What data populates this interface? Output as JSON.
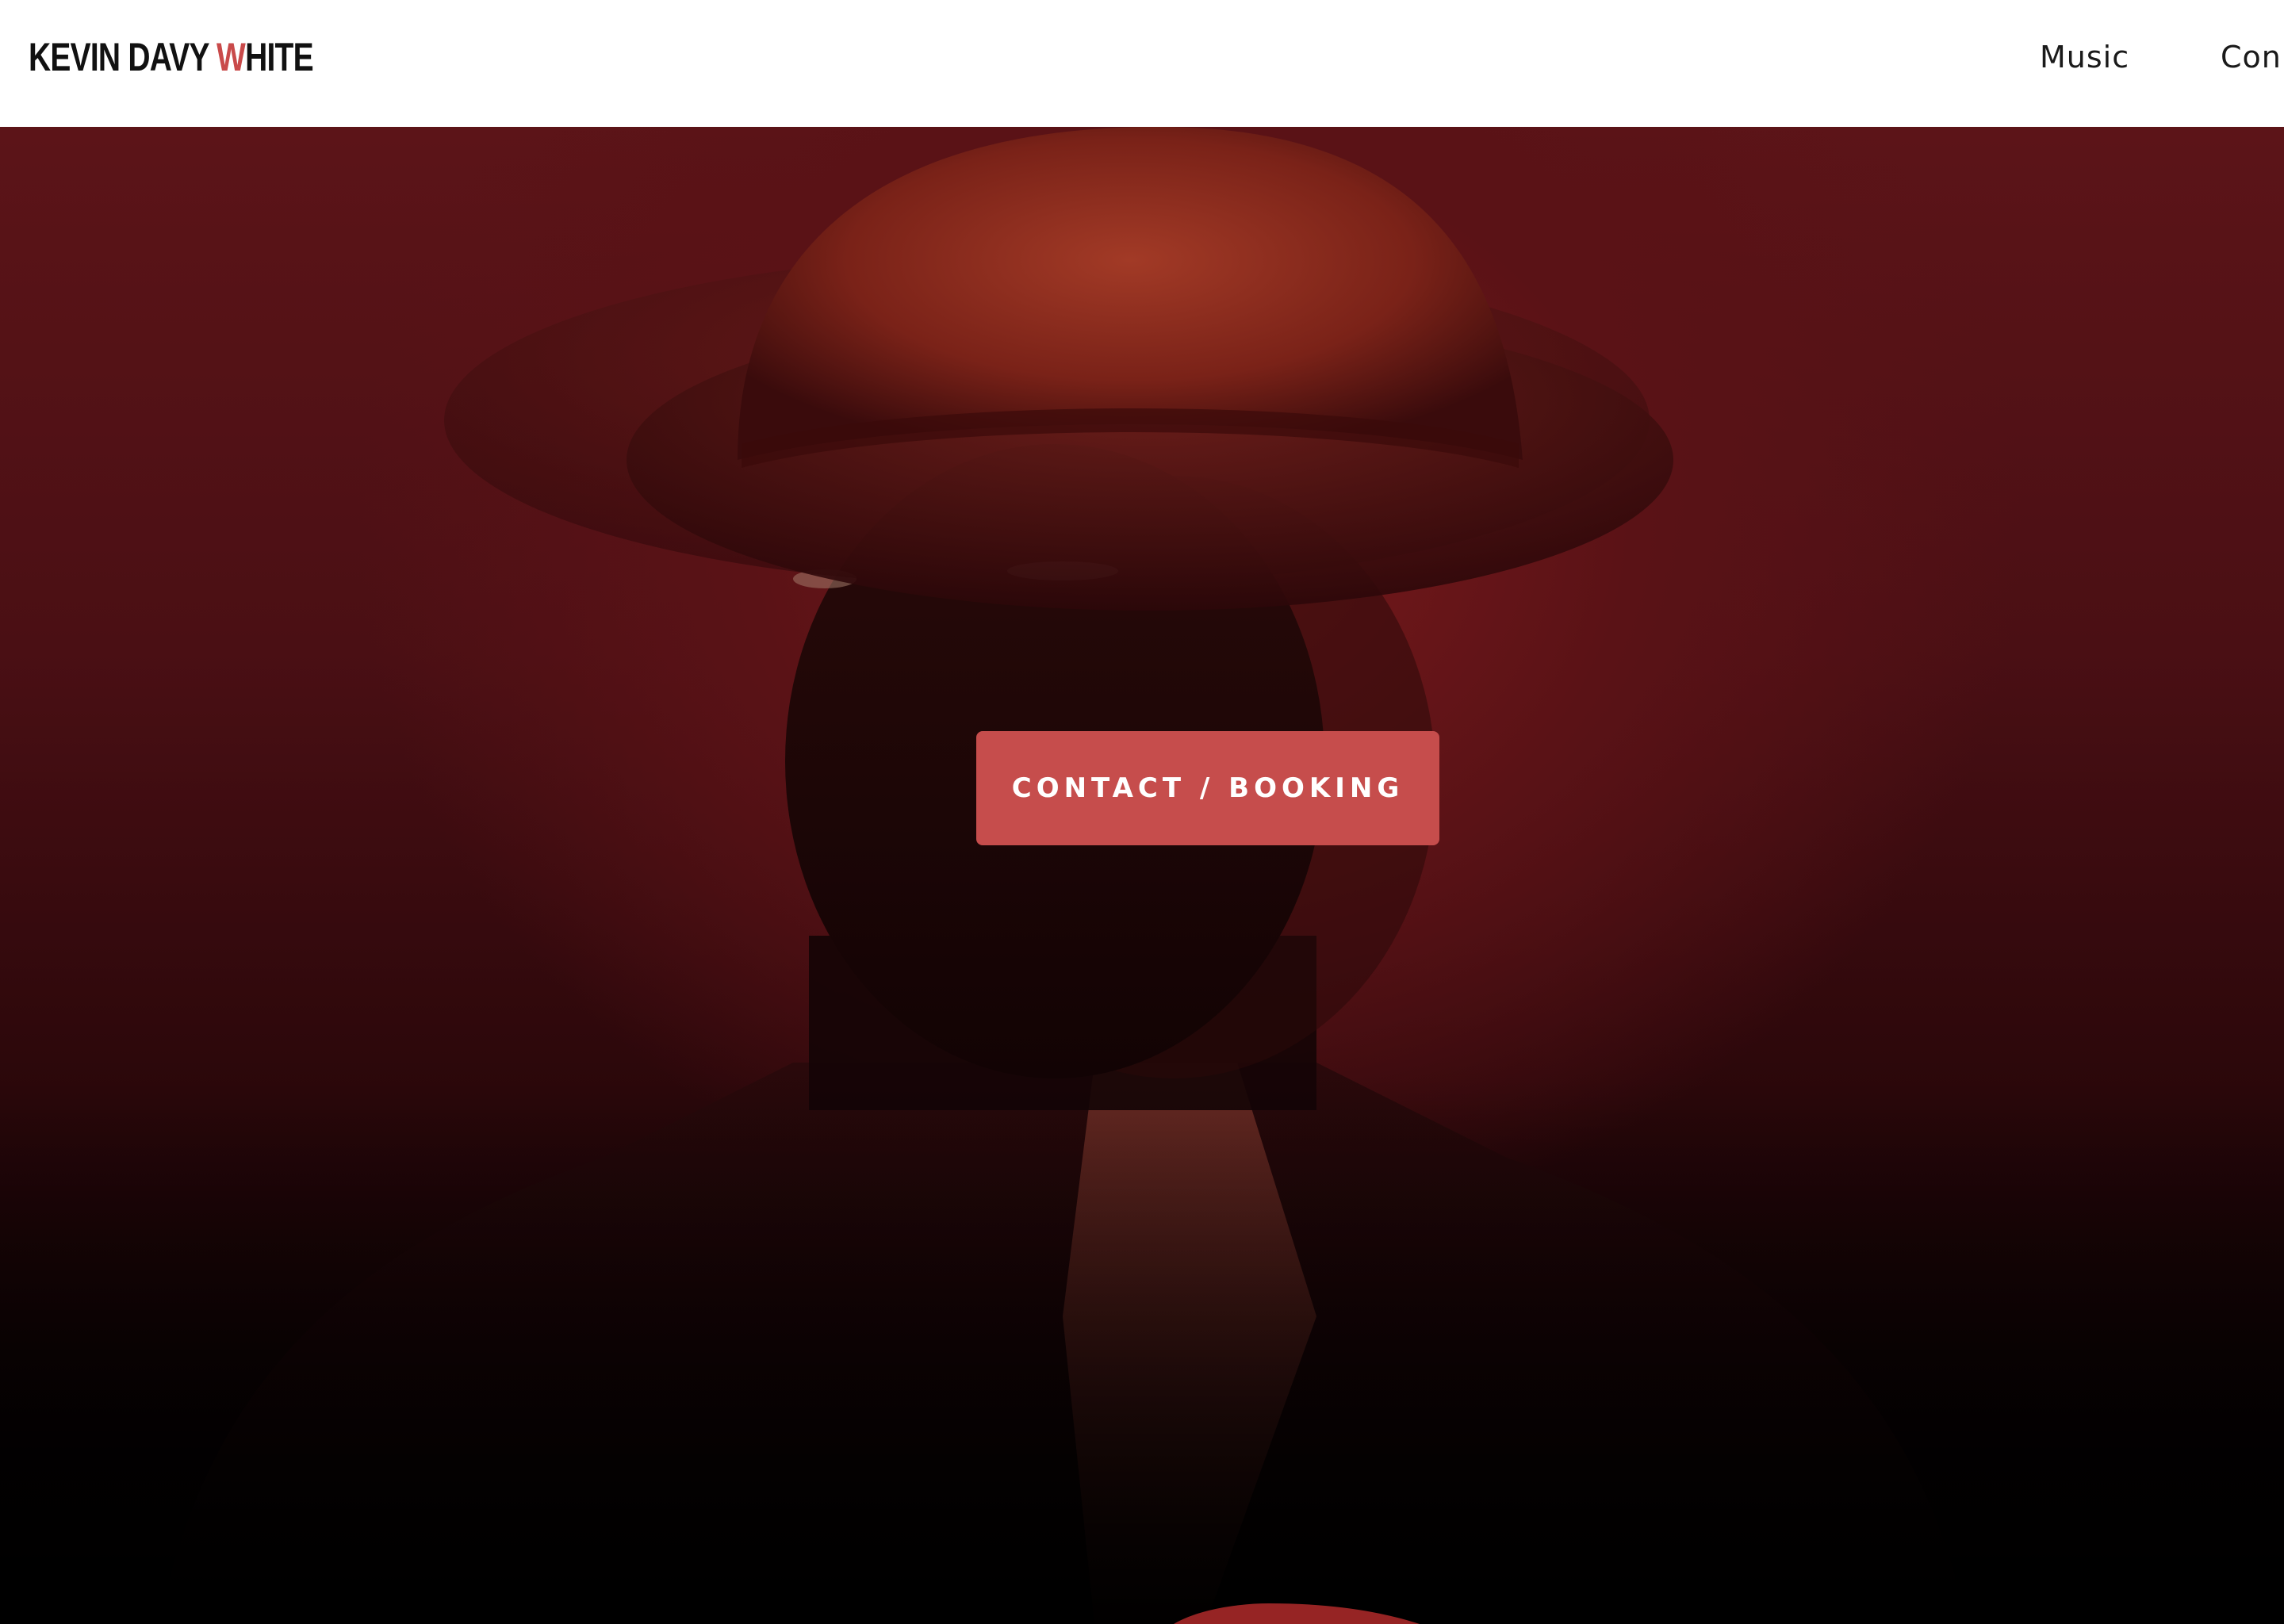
{
  "header": {
    "logo": {
      "part1": "KEVIN DAVY ",
      "accent": "W",
      "part2": "HITE"
    },
    "nav": [
      {
        "label": "Music"
      },
      {
        "label": "Con"
      }
    ]
  },
  "hero": {
    "cta_label": "CONTACT / BOOKING"
  },
  "colors": {
    "accent": "#c64d4c",
    "logo_accent": "#c94a4a",
    "hero_dark_red": "#5c1418"
  }
}
